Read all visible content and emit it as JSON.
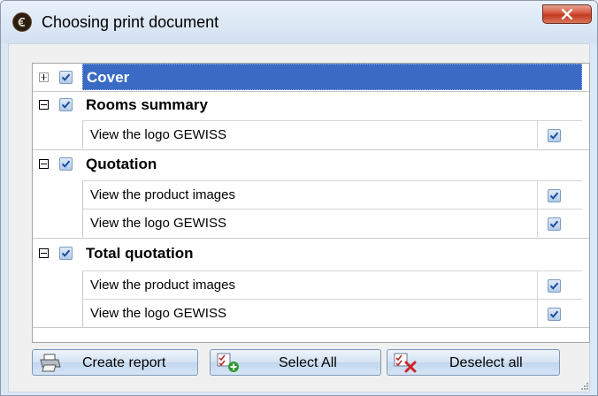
{
  "window": {
    "title": "Choosing print document",
    "close_symbol": "✕"
  },
  "tree": {
    "sections": [
      {
        "label": "Cover",
        "expander": "plus",
        "checked": true,
        "selected": true,
        "items": []
      },
      {
        "label": "Rooms summary",
        "expander": "minus",
        "checked": true,
        "items": [
          {
            "label": "View the logo GEWISS",
            "checked": true
          }
        ]
      },
      {
        "label": "Quotation",
        "expander": "minus",
        "checked": true,
        "items": [
          {
            "label": "View the product images",
            "checked": true
          },
          {
            "label": "View the logo GEWISS",
            "checked": true
          }
        ]
      },
      {
        "label": "Total quotation",
        "expander": "minus",
        "checked": true,
        "items": [
          {
            "label": "View the product images",
            "checked": true
          },
          {
            "label": "View the logo GEWISS",
            "checked": true
          }
        ]
      }
    ]
  },
  "buttons": {
    "create_report": "Create report",
    "select_all": "Select All",
    "deselect_all": "Deselect all"
  },
  "colors": {
    "selection": "#3a6bc4",
    "check": "#1a4fa8",
    "close": "#c23a20"
  }
}
